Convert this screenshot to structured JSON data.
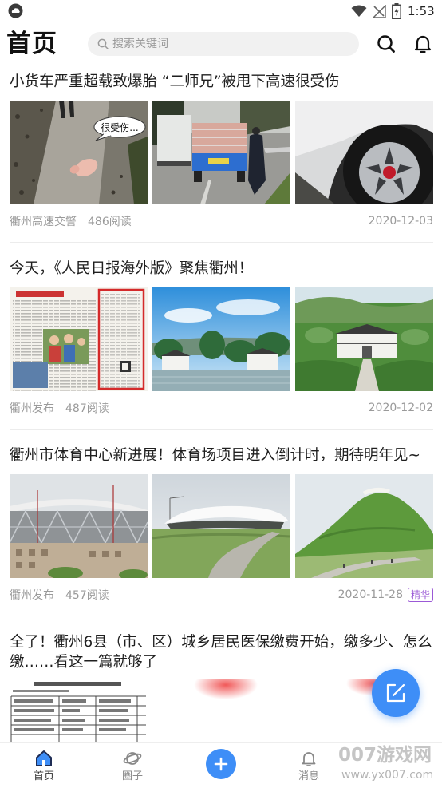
{
  "status_bar": {
    "time": "1:53"
  },
  "header": {
    "title": "首页",
    "search_placeholder": "搜索关键词"
  },
  "articles": [
    {
      "title": "小货车严重超载致爆胎 “二师兄”被甩下高速很受伤",
      "source": "衢州高速交警",
      "reads": "486阅读",
      "date": "2020-12-03",
      "thumbnail_text": "很受伤..."
    },
    {
      "title": "今天，《人民日报海外版》聚焦衢州！",
      "source": "衢州发布",
      "reads": "487阅读",
      "date": "2020-12-02"
    },
    {
      "title": "衢州市体育中心新进展！体育场项目进入倒计时，期待明年见~",
      "source": "衢州发布",
      "reads": "457阅读",
      "date": "2020-11-28",
      "badge": "精华"
    },
    {
      "title": "全了！衢州6县（市、区）城乡居民医保缴费开始，缴多少、怎么缴……看这一篇就够了"
    }
  ],
  "bottom_nav": {
    "home": "首页",
    "circle": "圈子",
    "messages": "消息"
  },
  "watermark": {
    "name": "007游戏网",
    "url": "www.yx007.com"
  },
  "colors": {
    "accent": "#3e8ef7",
    "title_text": "#1f1f1f",
    "meta_text": "#9a9a9a",
    "badge": "#9b59d6",
    "nav_active": "#1f2d55"
  },
  "icons": [
    "app-icon",
    "wifi-icon",
    "signal-icon",
    "battery-icon",
    "search-icon",
    "bell-icon",
    "home-icon",
    "planet-icon",
    "plus-icon",
    "edit-icon"
  ]
}
